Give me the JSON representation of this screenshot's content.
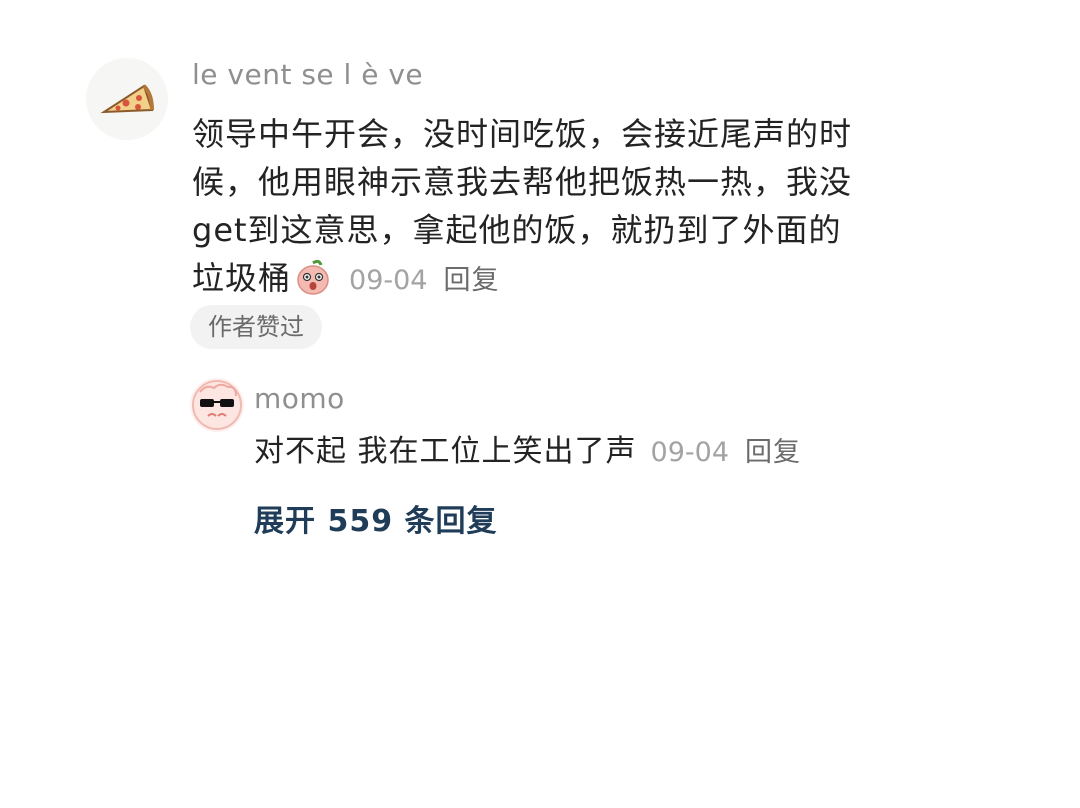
{
  "comment": {
    "username": "le vent se l è ve",
    "avatar_icon": "pizza-slice-icon",
    "text_lines": [
      "领导中午开会，没时间吃饭，会接近尾声的时",
      "候，他用眼神示意我去帮他把饭热一热，我没",
      "get到这意思，拿起他的饭，就扔到了外面的",
      "垃圾桶"
    ],
    "emoji_icon": "peach-surprised-emoji-icon",
    "date": "09-04",
    "reply_label": "回复",
    "author_liked_label": "作者赞过"
  },
  "reply": {
    "username": "momo",
    "avatar_icon": "sunglasses-face-icon",
    "text": "对不起 我在工位上笑出了声",
    "date": "09-04",
    "reply_label": "回复"
  },
  "expand_replies_label": "展开 559 条回复",
  "colors": {
    "username": "#8f8f8f",
    "body_text": "#232323",
    "date": "#a3a3a3",
    "link": "#1f3c58",
    "badge_bg": "#f2f2f2"
  }
}
